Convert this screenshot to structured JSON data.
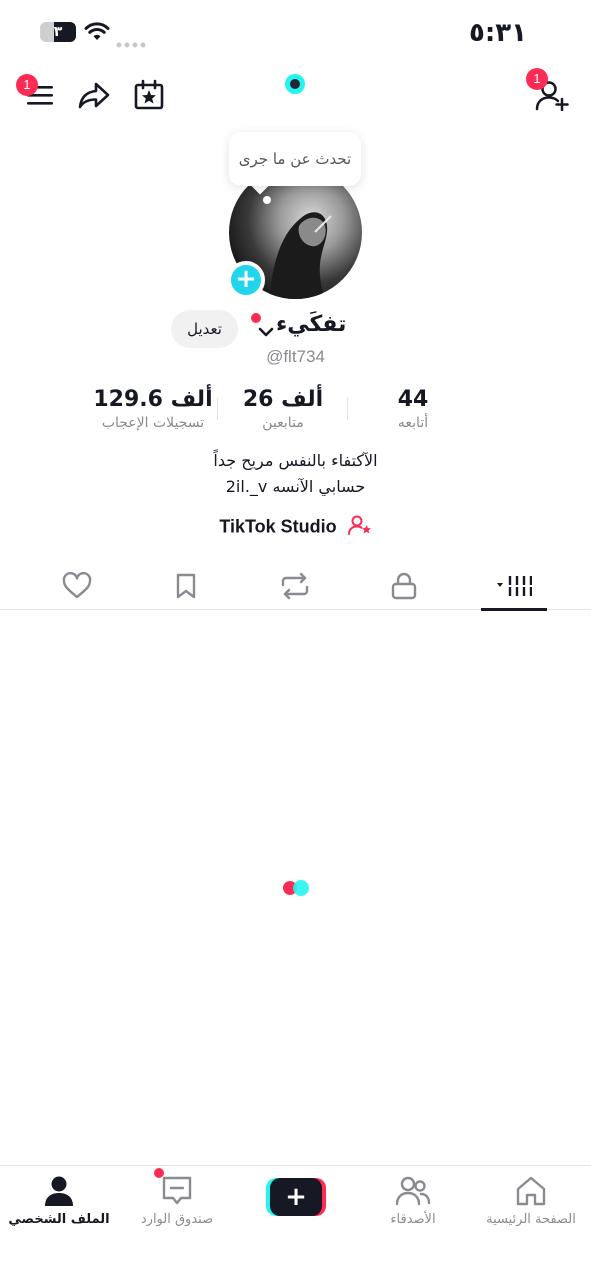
{
  "status_bar": {
    "time": "٥:٣١",
    "battery": "٣",
    "battery_level": 0.6
  },
  "top_bar": {
    "menu_badge": "1",
    "add_friend_badge": "1"
  },
  "tooltip": {
    "text": "تحدث عن ما جرى"
  },
  "profile": {
    "display_name": "تفكَيء",
    "handle": "@flt734",
    "edit_label": "تعديل"
  },
  "stats": [
    {
      "value": "44",
      "label": "أتابعه"
    },
    {
      "value": "26 ألف",
      "label": "متابعين"
    },
    {
      "value": "129.6 ألف",
      "label": "تسجيلات الإعجاب"
    }
  ],
  "bio": {
    "line1": "الآكتفاء بالنفس مريح جداً",
    "line2": "حسابي الآنسه 2il._v"
  },
  "studio": {
    "label": "TikTok Studio"
  },
  "tabs": [
    "videos-grid",
    "private-lock",
    "reposts",
    "favorites-bookmark",
    "liked-heart"
  ],
  "bottom_nav": {
    "home": "الصفحة الرئيسية",
    "friends": "الأصدقاء",
    "inbox": "صندوق الوارد",
    "profile": "الملف الشخصي"
  },
  "colors": {
    "accent_red": "#fe2c55",
    "accent_cyan": "#25f4ee",
    "text_dark": "#161823",
    "text_muted": "#8a8b91"
  }
}
